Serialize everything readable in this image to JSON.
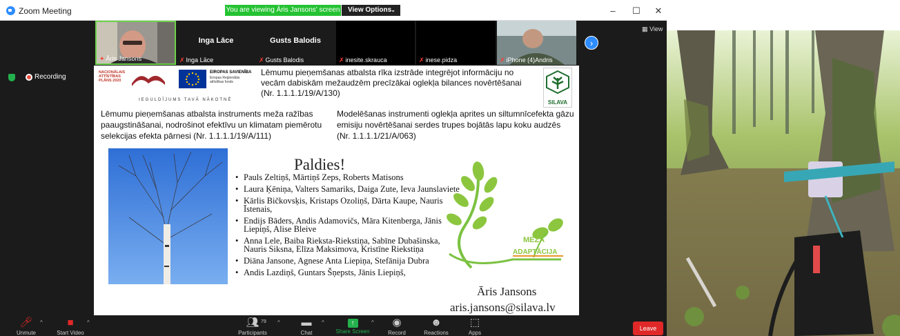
{
  "window": {
    "app_title": "Zoom Meeting",
    "viewing_banner": "You are viewing Āris Jansons' screen",
    "view_options": "View Options",
    "view_button": "View"
  },
  "gallery": [
    {
      "label": "Āris Jansons",
      "video": true
    },
    {
      "label": "Inga Lāce",
      "big_name": "Inga Lāce"
    },
    {
      "label": "Gusts Balodis",
      "big_name": "Gusts Balodis"
    },
    {
      "label": "inesite.skrauca"
    },
    {
      "label": "inese.pidza"
    },
    {
      "label": "iPhone (4)Andris",
      "video": true
    }
  ],
  "status": {
    "recording": "Recording"
  },
  "slide": {
    "nap_logo": "NACIONĀLAIS ATTĪSTĪBAS PLĀNS 2020",
    "eu_title": "EIROPAS SAVIENĪBA",
    "eu_sub": "Eiropas Reģionālās attīstības fonds",
    "tagline": "IEGULDĪJUMS TAVĀ NĀKOTNĒ",
    "heading": "Lēmumu pieņemšanas atbalsta rīka izstrāde integrējot informāciju no vecām dabiskām mežaudzēm precīzākai oglekļa bilances novērtēšanai (Nr. 1.1.1.1/19/A/130)",
    "silava_name": "SILAVA",
    "project_left": "Lēmumu pieņemšanas atbalsta instruments meža ražības paaugstināšanai, nodrošinot efektīvu un klimatam piemērotu selekcijas efekta pārnesi (Nr. 1.1.1.1/19/A/111)",
    "project_right": "Modelēšanas instrumenti oglekļa aprites un siltumnīcefekta gāzu emisiju novērtēšanai serdes trupes bojātās lapu koku audzēs (Nr. 1.1.1.1/21/A/063)",
    "thanks_title": "Paldies!",
    "thanks": [
      "Pauls Zeltiņš, Mārtiņš Zeps, Roberts Matisons",
      "Laura Ķēniņa, Valters Samariks, Daiga Zute, Ieva Jaunslaviete",
      "Kārlis Bičkovsķis, Kristaps Ozoliņš, Dārta Kaupe, Nauris Īstenais,",
      "Endijs Bāders, Andis Adamovičs, Māra Kitenberga, Jānis Liepiņš, Alise Bleive",
      "Anna Lele, Baiba Rieksta-Riekstiņa, Sabīne Dubašinska, Nauris Siksna, Elīza Maksimova, Kristīne Riekstiņa",
      "Diāna Jansone, Agnese Anta Liepiņa, Stefānija Dubra",
      "Andis Lazdiņš, Guntars Šņepsts, Jānis Liepiņš,"
    ],
    "meza_line1": "MEŽA",
    "meza_line2": "ADAPTĀCIJA",
    "author": "Āris Jansons",
    "email": "aris.jansons@silava.lv"
  },
  "toolbar": {
    "unmute": "Unmute",
    "start_video": "Start Video",
    "participants": "Participants",
    "participants_count": "79",
    "chat": "Chat",
    "share_screen": "Share Screen",
    "record": "Record",
    "reactions": "Reactions",
    "apps": "Apps",
    "leave": "Leave"
  },
  "colors": {
    "zoom_blue": "#2d8cff",
    "share_green": "#23b14d",
    "leave_red": "#e02828",
    "banner_green": "#24c232"
  }
}
